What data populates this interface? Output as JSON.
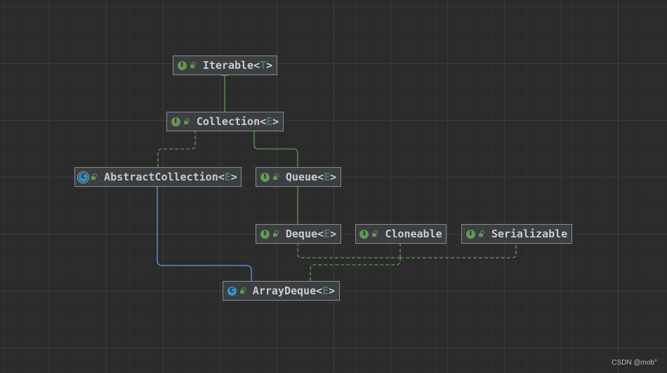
{
  "nodes": {
    "iterable": {
      "kind": "interface",
      "kind_letter": "I",
      "name": "Iterable<",
      "type_param": "T",
      "suffix": ">"
    },
    "collection": {
      "kind": "interface",
      "kind_letter": "I",
      "name": "Collection<",
      "type_param": "E",
      "suffix": ">"
    },
    "abstract_collection": {
      "kind": "abstract-class",
      "kind_letter": "C",
      "name": "AbstractCollection<",
      "type_param": "E",
      "suffix": ">"
    },
    "queue": {
      "kind": "interface",
      "kind_letter": "I",
      "name": "Queue<",
      "type_param": "E",
      "suffix": ">"
    },
    "deque": {
      "kind": "interface",
      "kind_letter": "I",
      "name": "Deque<",
      "type_param": "E",
      "suffix": ">"
    },
    "cloneable": {
      "kind": "interface",
      "kind_letter": "I",
      "name": "Cloneable",
      "type_param": "",
      "suffix": ""
    },
    "serializable": {
      "kind": "interface",
      "kind_letter": "I",
      "name": "Serializable",
      "type_param": "",
      "suffix": ""
    },
    "array_deque": {
      "kind": "class",
      "kind_letter": "C",
      "name": "ArrayDeque<",
      "type_param": "E",
      "suffix": ">"
    }
  },
  "edges": [
    {
      "from": "Collection",
      "to": "Iterable",
      "relation": "extends"
    },
    {
      "from": "AbstractCollection",
      "to": "Collection",
      "relation": "implements"
    },
    {
      "from": "Queue",
      "to": "Collection",
      "relation": "extends"
    },
    {
      "from": "Deque",
      "to": "Queue",
      "relation": "extends"
    },
    {
      "from": "ArrayDeque",
      "to": "AbstractCollection",
      "relation": "extends"
    },
    {
      "from": "ArrayDeque",
      "to": "Deque",
      "relation": "implements"
    },
    {
      "from": "ArrayDeque",
      "to": "Cloneable",
      "relation": "implements"
    },
    {
      "from": "ArrayDeque",
      "to": "Serializable",
      "relation": "implements"
    }
  ],
  "colors": {
    "background": "#2b2b2b",
    "node_fill": "#3c3f41",
    "node_border": "#8a8a8a",
    "interface_edge": "#629755",
    "class_edge": "#589df6",
    "type_param": "#507874"
  },
  "watermark": "CSDN @mob°"
}
